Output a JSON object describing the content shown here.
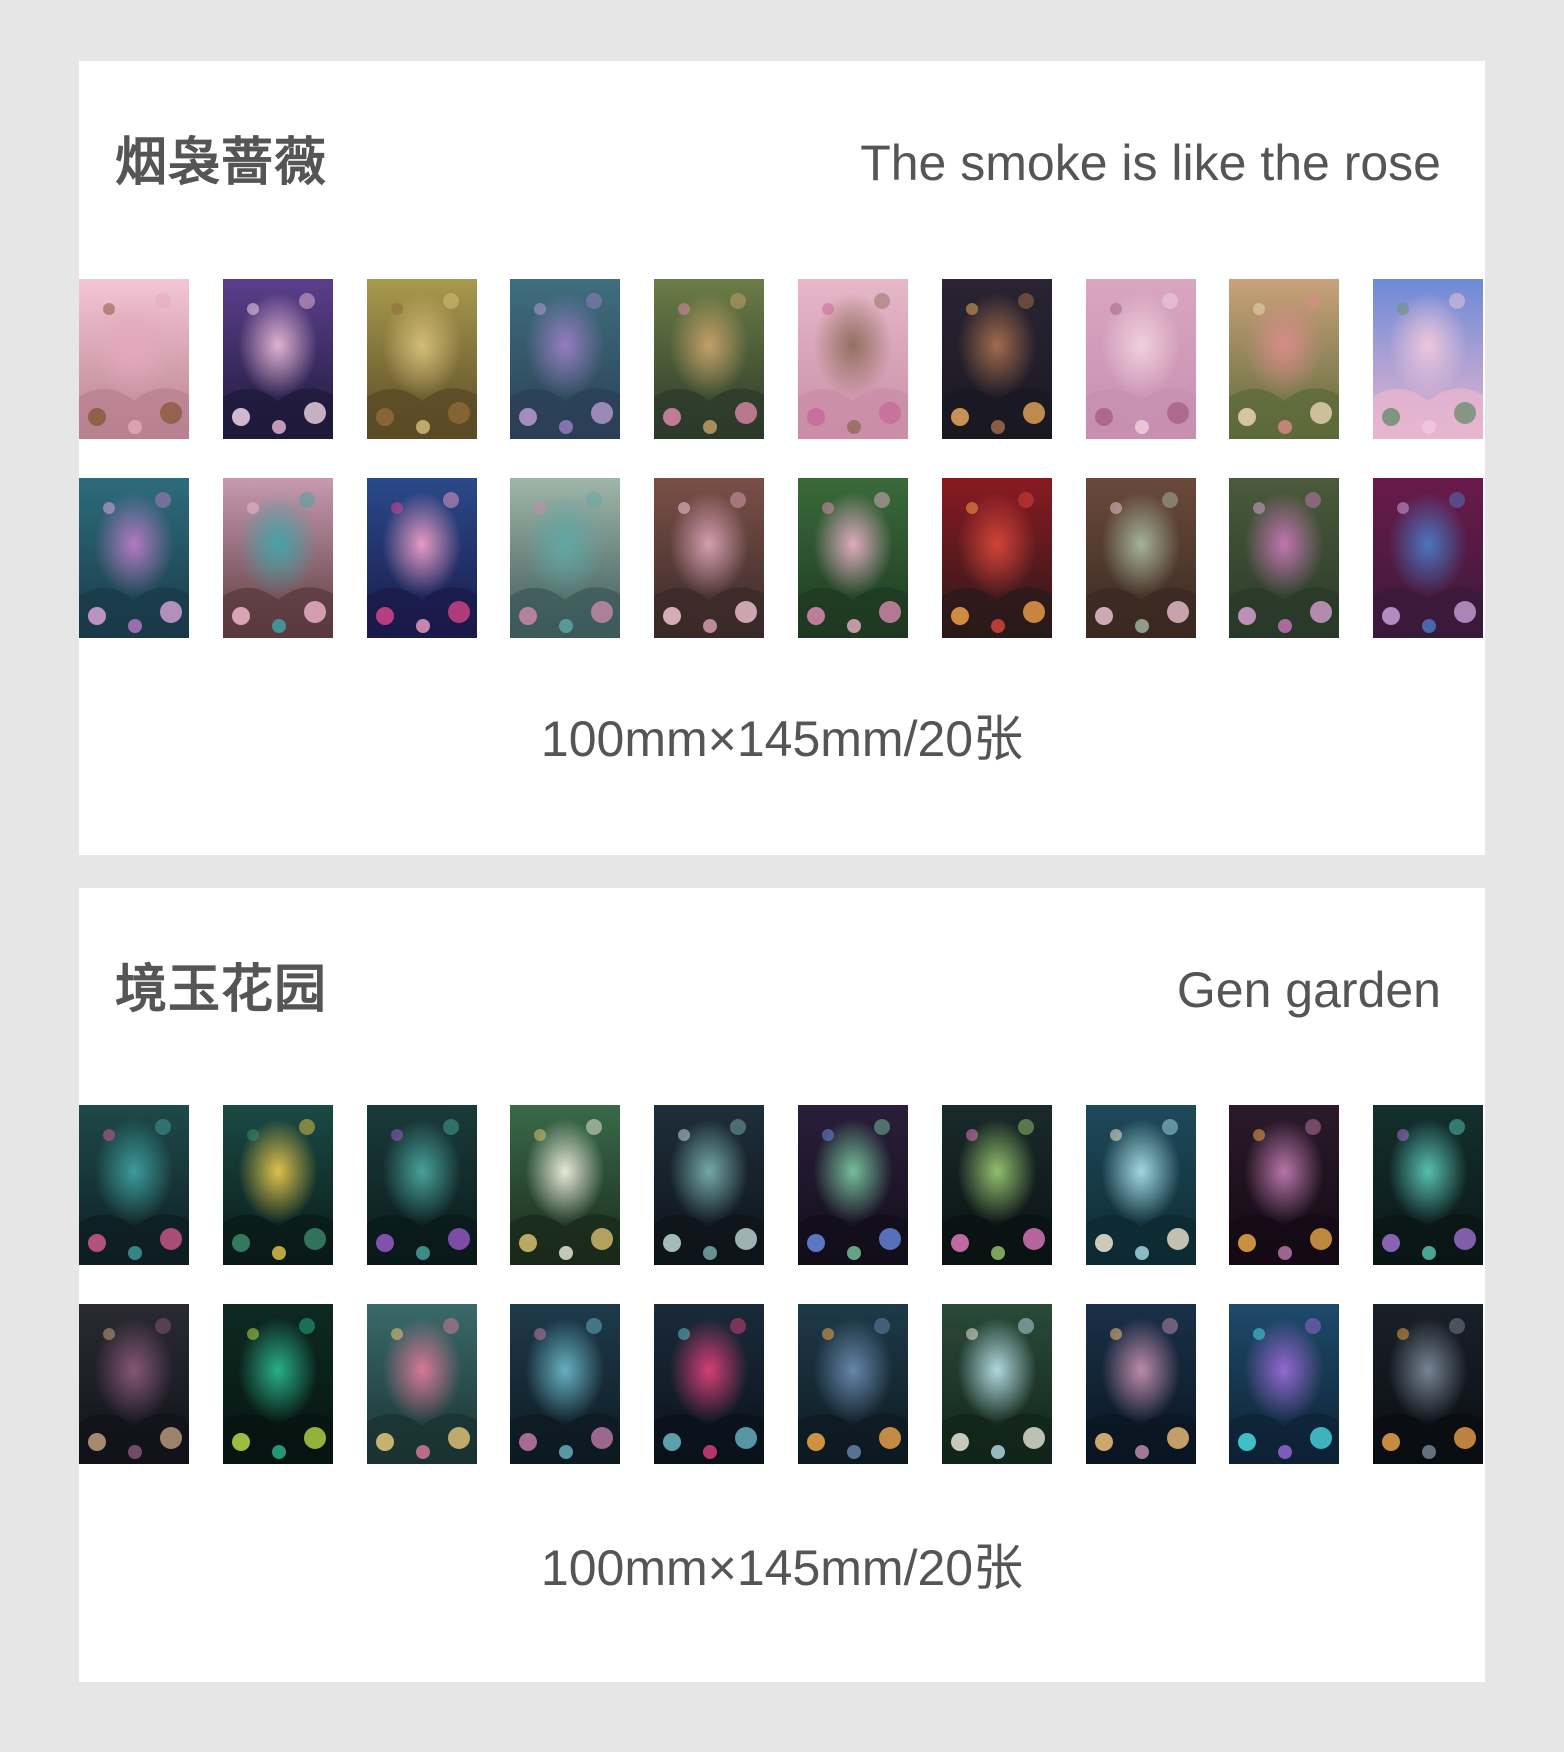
{
  "sets": [
    {
      "title_cn": "烟袅蔷薇",
      "title_en": "The smoke is like the rose",
      "spec": "100mm×145mm/20张",
      "rows": [
        [
          {
            "a": "#f3c6d6",
            "b": "#b9808f",
            "c": "#e6a8bd",
            "d": "#8a5a3e"
          },
          {
            "a": "#5b3f8c",
            "b": "#1e1a3a",
            "c": "#e8b9d6",
            "d": "#f0d6e6"
          },
          {
            "a": "#a89a4e",
            "b": "#5a4a26",
            "c": "#d7c07a",
            "d": "#8f6a3a"
          },
          {
            "a": "#3f6f7f",
            "b": "#2b3f55",
            "c": "#9a7fc4",
            "d": "#b79bd0"
          },
          {
            "a": "#6b7c46",
            "b": "#2c3a2a",
            "c": "#c9a36a",
            "d": "#d987a8"
          },
          {
            "a": "#e6b8c9",
            "b": "#c98ea5",
            "c": "#8f6c5a",
            "d": "#c76a9b"
          },
          {
            "a": "#2a2432",
            "b": "#1a1822",
            "c": "#a86f4e",
            "d": "#e8a85a"
          },
          {
            "a": "#d9a6c0",
            "b": "#c78fb0",
            "c": "#f2d2e0",
            "d": "#a86288"
          },
          {
            "a": "#c9a27a",
            "b": "#5c6a3a",
            "c": "#d98b8a",
            "d": "#e9d4b4"
          },
          {
            "a": "#6d8ad8",
            "b": "#e8b6cf",
            "c": "#f1c9dc",
            "d": "#6f8f70"
          }
        ],
        [
          {
            "a": "#2d6c7c",
            "b": "#1a3a48",
            "c": "#b97cc8",
            "d": "#d8a5d8"
          },
          {
            "a": "#c79ab0",
            "b": "#5a3a3e",
            "c": "#3fa6a8",
            "d": "#f0b6cc"
          },
          {
            "a": "#2a4a8a",
            "b": "#1a1a4a",
            "c": "#f0a0c8",
            "d": "#d4448a"
          },
          {
            "a": "#9fb6a8",
            "b": "#3c5a5a",
            "c": "#5fa8a6",
            "d": "#c88aa8"
          },
          {
            "a": "#7a5048",
            "b": "#3a2a28",
            "c": "#d9a2b6",
            "d": "#f0c4d2"
          },
          {
            "a": "#3a6a3a",
            "b": "#1e3a22",
            "c": "#e8b0c8",
            "d": "#d88ab0"
          },
          {
            "a": "#8a1a22",
            "b": "#2a1a1a",
            "c": "#d8463a",
            "d": "#f0a04a"
          },
          {
            "a": "#6a4a3a",
            "b": "#3a2a22",
            "c": "#a8b8a0",
            "d": "#e8c0d0"
          },
          {
            "a": "#4a5a3a",
            "b": "#2a3a2a",
            "c": "#c878b8",
            "d": "#d4a0d0"
          },
          {
            "a": "#6a1a4a",
            "b": "#3a1a3a",
            "c": "#4a7ac8",
            "d": "#c8a0d8"
          }
        ]
      ]
    },
    {
      "title_cn": "境玉花园",
      "title_en": "Gen garden",
      "spec": "100mm×145mm/20张",
      "rows": [
        [
          {
            "a": "#1e4a4a",
            "b": "#0e1e22",
            "c": "#3fa0a0",
            "d": "#d05a8a"
          },
          {
            "a": "#1a4a44",
            "b": "#0a1a18",
            "c": "#e8c84a",
            "d": "#3a8a6a"
          },
          {
            "a": "#1a3a3a",
            "b": "#0a1a1a",
            "c": "#4aa8a0",
            "d": "#9a5ac8"
          },
          {
            "a": "#3a6a4a",
            "b": "#1a2a1a",
            "c": "#f0f0e0",
            "d": "#d8c070"
          },
          {
            "a": "#1e2e3a",
            "b": "#0e141a",
            "c": "#7ab0b0",
            "d": "#c0d8d8"
          },
          {
            "a": "#2a1e3a",
            "b": "#120e1a",
            "c": "#7ac8a0",
            "d": "#6a8ae0"
          },
          {
            "a": "#1a2a2a",
            "b": "#0a1212",
            "c": "#9ac870",
            "d": "#e07ac0"
          },
          {
            "a": "#1e4a5a",
            "b": "#0e2a32",
            "c": "#a8e0e8",
            "d": "#f0e6d0"
          },
          {
            "a": "#2a1a2a",
            "b": "#140a14",
            "c": "#c07ab0",
            "d": "#e8a84a"
          },
          {
            "a": "#14302e",
            "b": "#0a1616",
            "c": "#5ac8b8",
            "d": "#a070d0"
          }
        ],
        [
          {
            "a": "#2a2a32",
            "b": "#12121a",
            "c": "#8a5a7a",
            "d": "#c0a080"
          },
          {
            "a": "#0e2a22",
            "b": "#061410",
            "c": "#2ab88a",
            "d": "#b8d84a"
          },
          {
            "a": "#3a6a6a",
            "b": "#1a3232",
            "c": "#e07a9a",
            "d": "#e8c87a"
          },
          {
            "a": "#1e3a4a",
            "b": "#0e1a22",
            "c": "#6ab8c8",
            "d": "#c07aa8"
          },
          {
            "a": "#1a2a3a",
            "b": "#0a121a",
            "c": "#e0407a",
            "d": "#6ab8c8"
          },
          {
            "a": "#1e3a48",
            "b": "#0e1a22",
            "c": "#6a8ab0",
            "d": "#f0a84a"
          },
          {
            "a": "#2a4a3a",
            "b": "#12241a",
            "c": "#b8e0e8",
            "d": "#e8e8d8"
          },
          {
            "a": "#1a3048",
            "b": "#0a1622",
            "c": "#c890b0",
            "d": "#f0c07a"
          },
          {
            "a": "#1e4a6a",
            "b": "#0e2234",
            "c": "#9a6ad8",
            "d": "#4ad8e0"
          },
          {
            "a": "#1a2028",
            "b": "#0a0e12",
            "c": "#7a8a9a",
            "d": "#e8a04a"
          }
        ]
      ]
    }
  ]
}
